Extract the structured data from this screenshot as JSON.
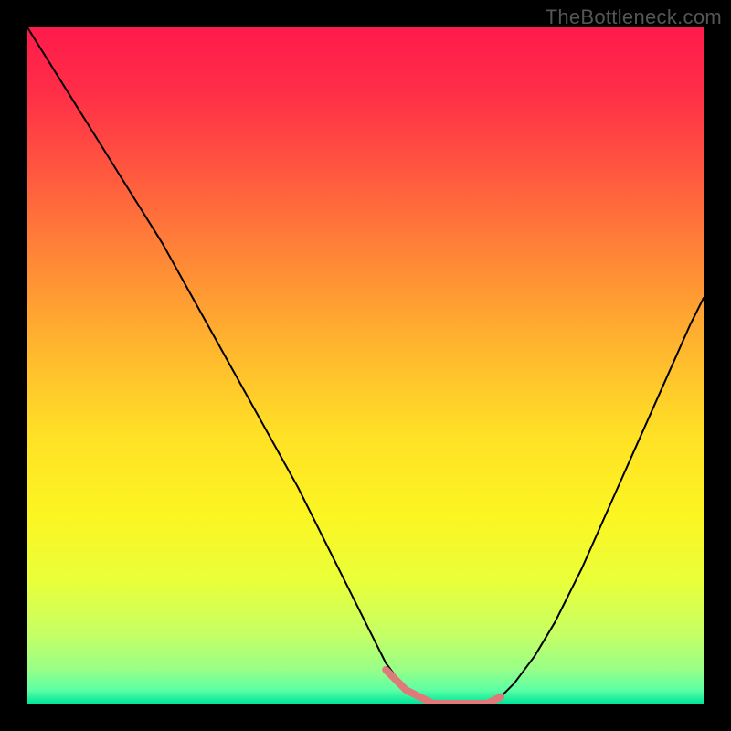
{
  "watermark": "TheBottleneck.com",
  "chart_data": {
    "type": "line",
    "title": "",
    "xlabel": "",
    "ylabel": "",
    "xlim": [
      0,
      100
    ],
    "ylim": [
      0,
      100
    ],
    "legend": false,
    "gradient_stops": [
      {
        "offset": 0.0,
        "color": "#ff1a4b"
      },
      {
        "offset": 0.1,
        "color": "#ff2f47"
      },
      {
        "offset": 0.22,
        "color": "#ff5a3f"
      },
      {
        "offset": 0.35,
        "color": "#ff8a36"
      },
      {
        "offset": 0.48,
        "color": "#ffb82e"
      },
      {
        "offset": 0.6,
        "color": "#ffe026"
      },
      {
        "offset": 0.72,
        "color": "#fcf522"
      },
      {
        "offset": 0.82,
        "color": "#e9ff3a"
      },
      {
        "offset": 0.9,
        "color": "#c4ff66"
      },
      {
        "offset": 0.95,
        "color": "#97ff88"
      },
      {
        "offset": 0.98,
        "color": "#5cffa4"
      },
      {
        "offset": 1.0,
        "color": "#00e59a"
      }
    ],
    "series": [
      {
        "name": "bottleneck-curve",
        "color": "#000000",
        "width": 2,
        "x": [
          0,
          5,
          10,
          15,
          20,
          25,
          30,
          35,
          40,
          45,
          50,
          53,
          56,
          60,
          64,
          68,
          70,
          72,
          75,
          78,
          82,
          86,
          90,
          94,
          98,
          100
        ],
        "y": [
          100,
          92,
          84,
          76,
          68,
          59,
          50,
          41,
          32,
          22,
          12,
          6,
          2,
          0,
          0,
          0,
          1,
          3,
          7,
          12,
          20,
          29,
          38,
          47,
          56,
          60
        ]
      },
      {
        "name": "flat-highlight",
        "color": "#e07a7a",
        "width": 8,
        "x": [
          53,
          56,
          60,
          64,
          68,
          70
        ],
        "y": [
          5,
          2,
          0,
          0,
          0,
          1
        ]
      }
    ]
  }
}
